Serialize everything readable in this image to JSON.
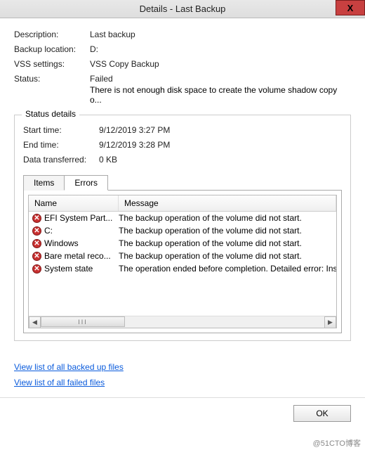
{
  "window": {
    "title": "Details - Last Backup",
    "close_symbol": "X"
  },
  "info": {
    "description_label": "Description:",
    "description_value": "Last backup",
    "location_label": "Backup location:",
    "location_value": "D:",
    "vss_label": "VSS settings:",
    "vss_value": "VSS Copy Backup",
    "status_label": "Status:",
    "status_value": "Failed",
    "status_detail": "There is not enough disk space to create the volume shadow copy o..."
  },
  "group": {
    "title": "Status details",
    "start_label": "Start time:",
    "start_value": "9/12/2019 3:27 PM",
    "end_label": "End time:",
    "end_value": "9/12/2019 3:28 PM",
    "data_label": "Data transferred:",
    "data_value": "0 KB"
  },
  "tabs": {
    "items_label": "Items",
    "errors_label": "Errors"
  },
  "table": {
    "header_name": "Name",
    "header_message": "Message",
    "rows": [
      {
        "name": "EFI System Part...",
        "message": "The backup operation of the volume did not start."
      },
      {
        "name": "C:",
        "message": "The backup operation of the volume did not start."
      },
      {
        "name": "Windows",
        "message": "The backup operation of the volume did not start."
      },
      {
        "name": "Bare metal reco...",
        "message": "The backup operation of the volume did not start."
      },
      {
        "name": "System state",
        "message": "The operation ended before completion. Detailed error: Ins"
      }
    ],
    "error_x": "✕",
    "scroll_left": "◀",
    "scroll_right": "▶",
    "thumb": "III"
  },
  "links": {
    "backed_up": "View list of all backed up files",
    "failed": "View list of all failed files"
  },
  "footer": {
    "ok": "OK"
  },
  "watermark": "@51CTO博客"
}
